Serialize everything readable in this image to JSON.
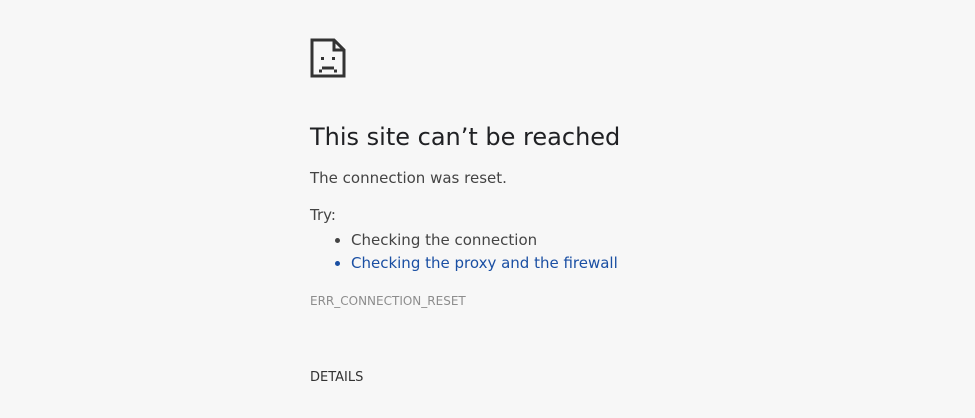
{
  "error_page": {
    "icon": "sad-document-icon",
    "title": "This site can’t be reached",
    "message": "The connection was reset.",
    "try_label": "Try:",
    "suggestions": [
      {
        "label": "Checking the connection",
        "is_link": false
      },
      {
        "label": "Checking the proxy and the firewall",
        "is_link": true
      }
    ],
    "error_code": "ERR_CONNECTION_RESET",
    "details_label": "DETAILS"
  },
  "colors": {
    "background": "#f7f7f7",
    "text": "#444444",
    "title": "#202124",
    "link": "#1a4fa3",
    "error_code": "#8d8d8d"
  }
}
